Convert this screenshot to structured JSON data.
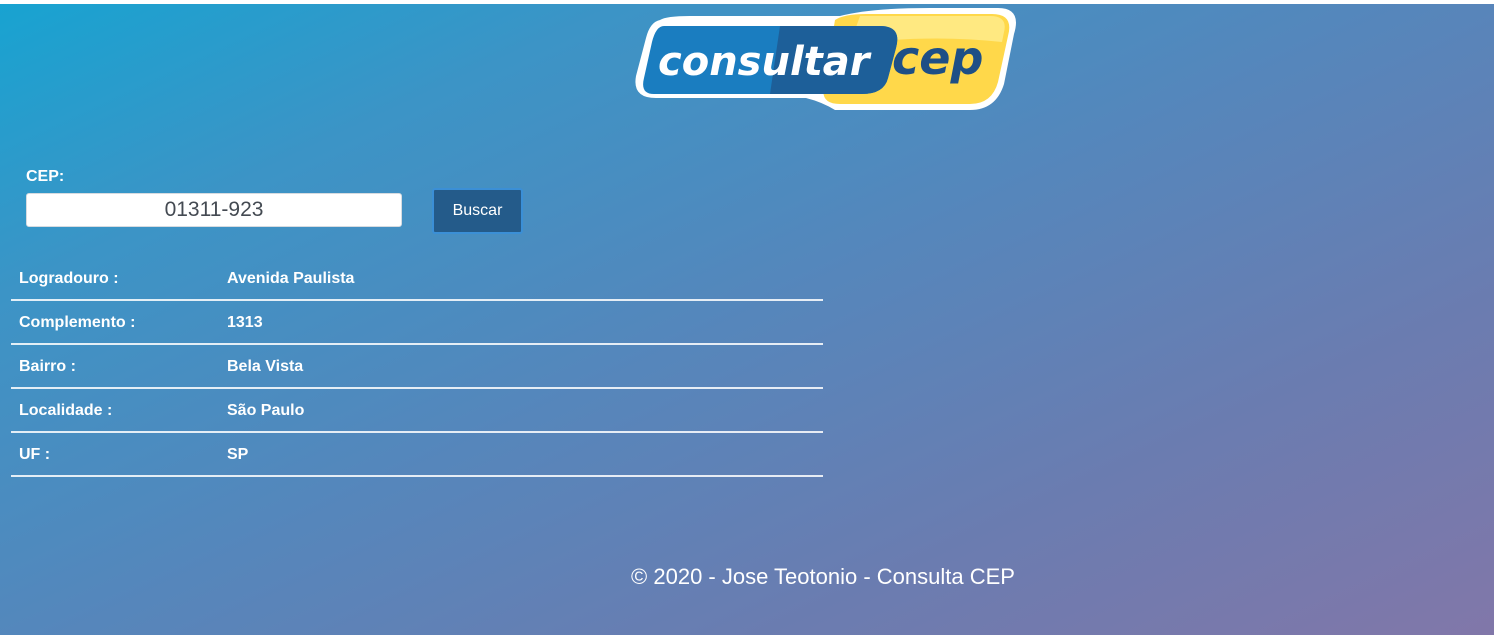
{
  "logo": {
    "text_left": "consultar",
    "text_right": "cep"
  },
  "form": {
    "cep_label": "CEP:",
    "cep_value": "01311-923",
    "search_button_label": "Buscar"
  },
  "results": [
    {
      "label": "Logradouro :",
      "value": "Avenida Paulista"
    },
    {
      "label": "Complemento :",
      "value": "1313"
    },
    {
      "label": "Bairro :",
      "value": "Bela Vista"
    },
    {
      "label": "Localidade :",
      "value": "São Paulo"
    },
    {
      "label": "UF :",
      "value": "SP"
    }
  ],
  "footer": {
    "text": "© 2020 - Jose Teotonio - Consulta CEP"
  },
  "colors": {
    "gradient_start": "#18a3d1",
    "gradient_end": "#8177a9",
    "button_bg": "#245b8a",
    "logo_blue": "#1a7dc0",
    "logo_yellow": "#ffd84a"
  }
}
